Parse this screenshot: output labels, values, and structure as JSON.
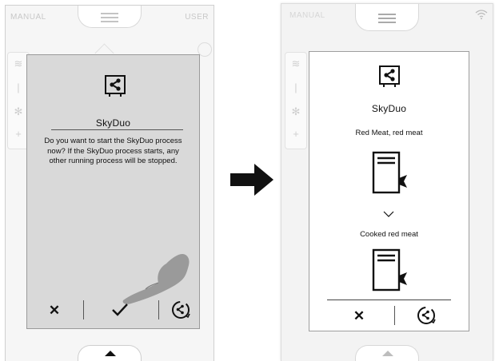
{
  "left_screen": {
    "topbar": {
      "left_label": "MANUAL",
      "right_label": "USER"
    },
    "dialog": {
      "title": "SkyDuo",
      "message": "Do you want to start the SkyDuo process now? If the SkyDuo process starts, any other running process will be stopped.",
      "cancel_icon": "close-icon",
      "confirm_icon": "checkmark-icon",
      "skyduo_icon": "skyduo-cycle-icon"
    }
  },
  "transition_arrow": "arrow-right-icon",
  "right_screen": {
    "topbar": {
      "left_label": "MANUAL",
      "right_icon": "wifi-icon"
    },
    "dialog": {
      "title": "SkyDuo",
      "from_label": "Red Meat, red meat",
      "to_label": "Cooked red meat",
      "cancel_icon": "close-icon",
      "skyduo_icon": "skyduo-cycle-icon"
    }
  },
  "colors": {
    "dialog_left_bg": "#d9d9d9",
    "hand_gray": "#9a9a9a"
  }
}
